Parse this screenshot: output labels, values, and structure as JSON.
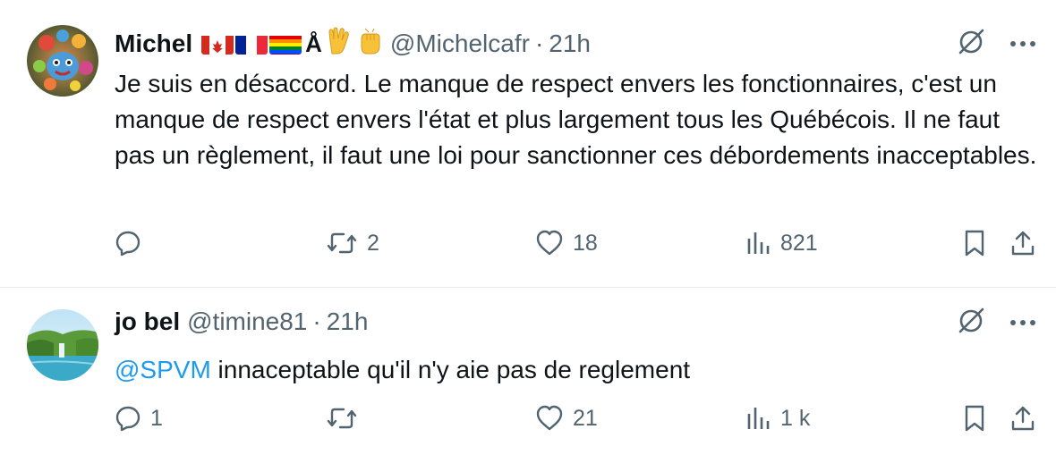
{
  "tweets": [
    {
      "name": "Michel",
      "badges": [
        "canada-flag",
        "france-flag",
        "rainbow-flag",
        "Å",
        "✌",
        "✊"
      ],
      "handle": "@Michelcafr",
      "time": "21h",
      "text": "Je suis en désaccord. Le manque de respect envers les fonctionnaires, c'est un manque de respect envers l'état et plus largement tous les Québécois. Il ne faut pas un règlement, il faut une loi pour sanctionner ces débordements inacceptables.",
      "reply_count": "",
      "retweet_count": "2",
      "like_count": "18",
      "view_count": "821"
    },
    {
      "name": "jo bel",
      "handle": "@timine81",
      "time": "21h",
      "mention": "@SPVM",
      "text": " innaceptable qu'il n'y aie pas de reglement",
      "reply_count": "1",
      "retweet_count": "",
      "like_count": "21",
      "view_count": "1 k"
    }
  ],
  "separator": "·",
  "colors": {
    "text": "#0f1419",
    "secondary": "#536471",
    "link": "#1d9bf0",
    "border": "#e6ecf0"
  },
  "icons": [
    "reply-icon",
    "retweet-icon",
    "like-icon",
    "views-icon",
    "bookmark-icon",
    "share-icon",
    "grok-icon",
    "more-icon"
  ]
}
